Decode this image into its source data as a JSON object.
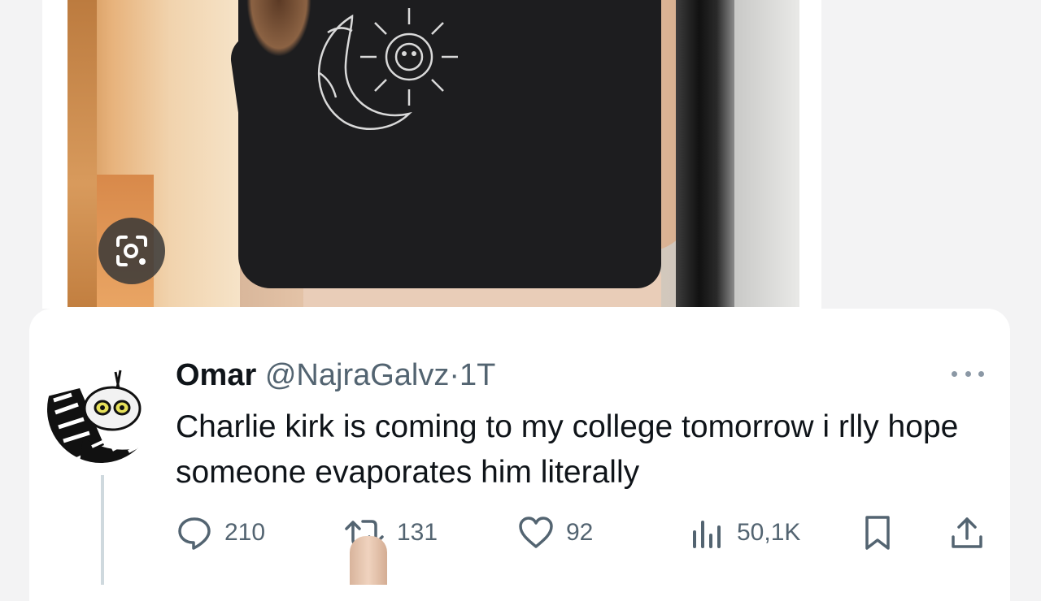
{
  "photo": {
    "lens_icon": "lens-search-icon"
  },
  "tweet": {
    "display_name": "Omar",
    "handle": "@NajraGalvz",
    "separator": "·",
    "time": "1T",
    "text": "Charlie kirk is coming to my college tomorrow i rlly hope someone evaporates him literally",
    "more_icon": "more-dots-icon",
    "actions": {
      "replies": "210",
      "reposts": "131",
      "likes": "92",
      "views": "50,1K"
    }
  },
  "colors": {
    "text_primary": "#0f1419",
    "text_secondary": "#536471",
    "card_bg": "#ffffff",
    "page_bg": "#f3f3f4"
  }
}
